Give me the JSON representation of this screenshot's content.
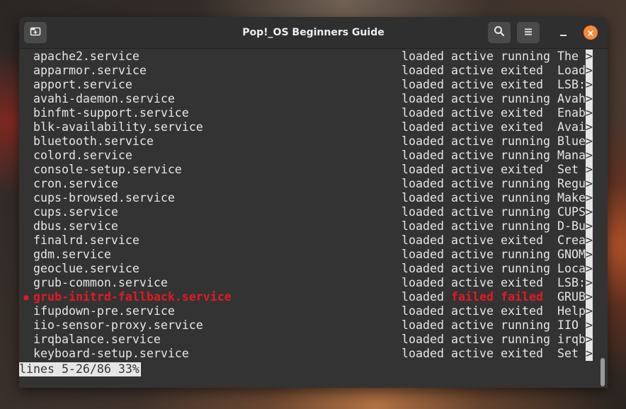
{
  "window": {
    "title": "Pop!_OS Beginners Guide"
  },
  "titlebar": {
    "new_tab_icon": "new-tab-icon",
    "search_icon": "search-icon",
    "menu_icon": "hamburger-menu-icon",
    "minimize_icon": "minimize-icon",
    "close_icon": "close-icon",
    "close_color": "#fb8737"
  },
  "terminal": {
    "rows": [
      {
        "marker": "",
        "unit": "apache2.service",
        "load": "loaded",
        "active": "active",
        "sub": "running",
        "desc": "The "
      },
      {
        "marker": "",
        "unit": "apparmor.service",
        "load": "loaded",
        "active": "active",
        "sub": "exited ",
        "desc": "Load"
      },
      {
        "marker": "",
        "unit": "apport.service",
        "load": "loaded",
        "active": "active",
        "sub": "exited ",
        "desc": "LSB:"
      },
      {
        "marker": "",
        "unit": "avahi-daemon.service",
        "load": "loaded",
        "active": "active",
        "sub": "running",
        "desc": "Avah"
      },
      {
        "marker": "",
        "unit": "binfmt-support.service",
        "load": "loaded",
        "active": "active",
        "sub": "exited ",
        "desc": "Enab"
      },
      {
        "marker": "",
        "unit": "blk-availability.service",
        "load": "loaded",
        "active": "active",
        "sub": "exited ",
        "desc": "Avai"
      },
      {
        "marker": "",
        "unit": "bluetooth.service",
        "load": "loaded",
        "active": "active",
        "sub": "running",
        "desc": "Blue"
      },
      {
        "marker": "",
        "unit": "colord.service",
        "load": "loaded",
        "active": "active",
        "sub": "running",
        "desc": "Mana"
      },
      {
        "marker": "",
        "unit": "console-setup.service",
        "load": "loaded",
        "active": "active",
        "sub": "exited ",
        "desc": "Set "
      },
      {
        "marker": "",
        "unit": "cron.service",
        "load": "loaded",
        "active": "active",
        "sub": "running",
        "desc": "Regu"
      },
      {
        "marker": "",
        "unit": "cups-browsed.service",
        "load": "loaded",
        "active": "active",
        "sub": "running",
        "desc": "Make"
      },
      {
        "marker": "",
        "unit": "cups.service",
        "load": "loaded",
        "active": "active",
        "sub": "running",
        "desc": "CUPS"
      },
      {
        "marker": "",
        "unit": "dbus.service",
        "load": "loaded",
        "active": "active",
        "sub": "running",
        "desc": "D-Bu"
      },
      {
        "marker": "",
        "unit": "finalrd.service",
        "load": "loaded",
        "active": "active",
        "sub": "exited ",
        "desc": "Crea"
      },
      {
        "marker": "",
        "unit": "gdm.service",
        "load": "loaded",
        "active": "active",
        "sub": "running",
        "desc": "GNOM"
      },
      {
        "marker": "",
        "unit": "geoclue.service",
        "load": "loaded",
        "active": "active",
        "sub": "running",
        "desc": "Loca"
      },
      {
        "marker": "",
        "unit": "grub-common.service",
        "load": "loaded",
        "active": "active",
        "sub": "exited ",
        "desc": "LSB:"
      },
      {
        "marker": "●",
        "unit": "grub-initrd-fallback.service",
        "load": "loaded",
        "active": "failed",
        "sub": "failed ",
        "desc": "GRUB",
        "failed": true
      },
      {
        "marker": "",
        "unit": "ifupdown-pre.service",
        "load": "loaded",
        "active": "active",
        "sub": "exited ",
        "desc": "Help"
      },
      {
        "marker": "",
        "unit": "iio-sensor-proxy.service",
        "load": "loaded",
        "active": "active",
        "sub": "running",
        "desc": "IIO "
      },
      {
        "marker": "",
        "unit": "irqbalance.service",
        "load": "loaded",
        "active": "active",
        "sub": "running",
        "desc": "irqb"
      },
      {
        "marker": "",
        "unit": "keyboard-setup.service",
        "load": "loaded",
        "active": "active",
        "sub": "exited ",
        "desc": "Set "
      }
    ],
    "truncation_marker": ">",
    "status_line": "lines 5-26/86 33%"
  }
}
